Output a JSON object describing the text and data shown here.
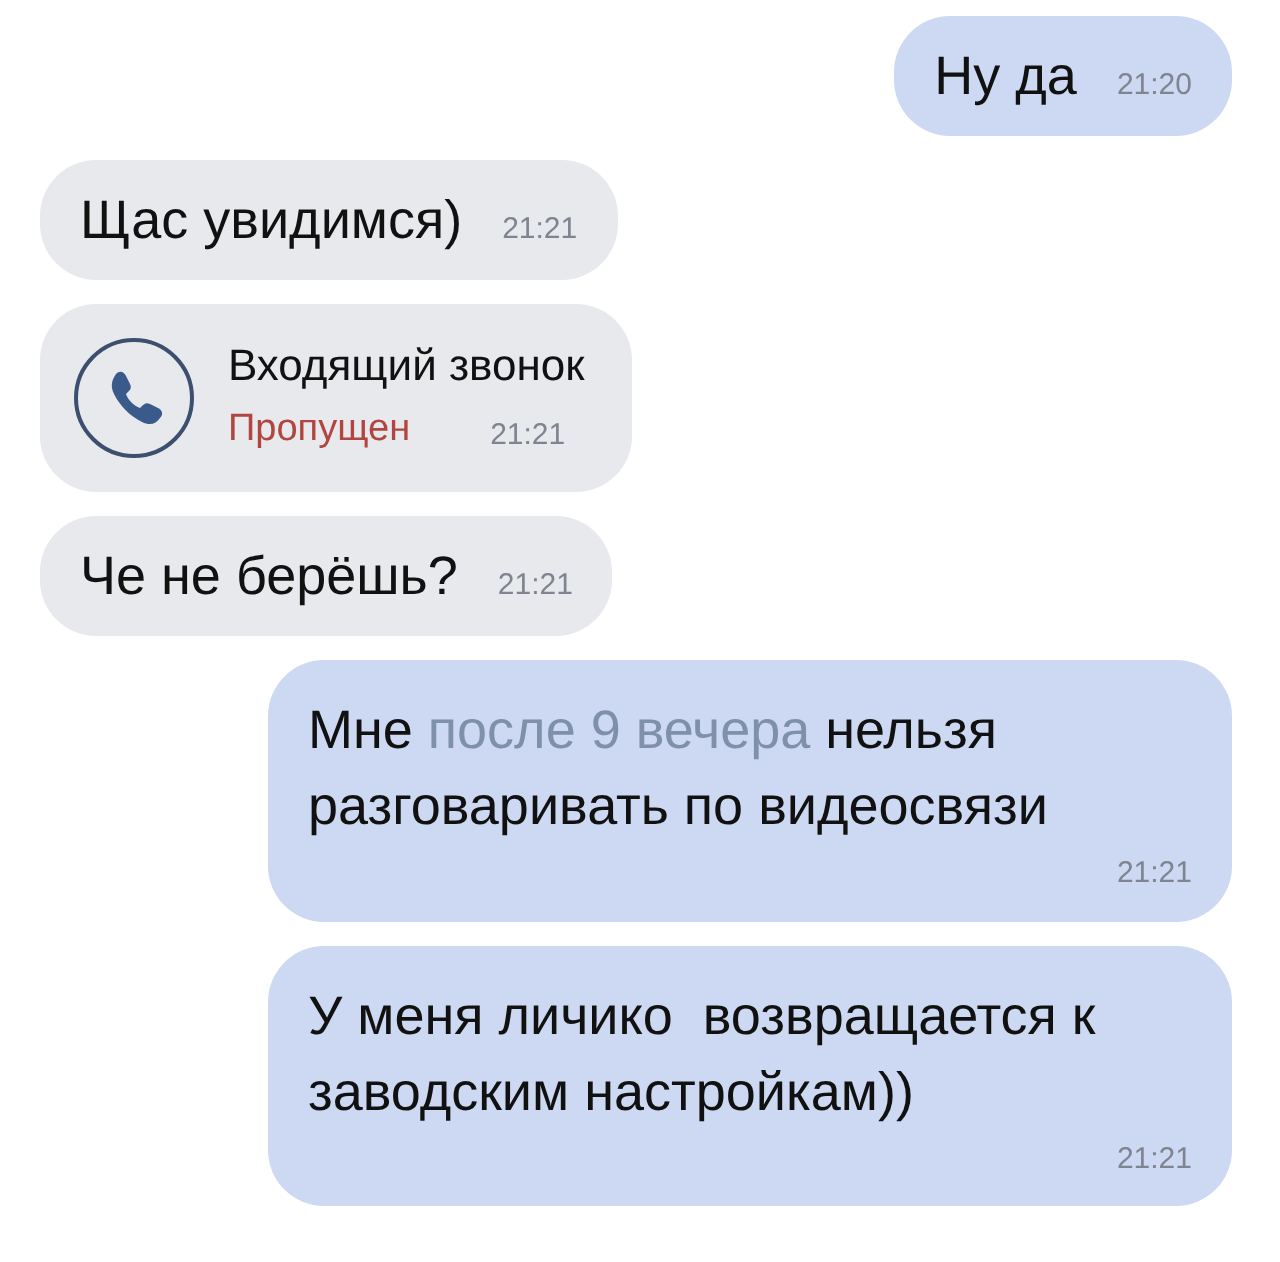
{
  "messages": [
    {
      "outgoing": true,
      "kind": "text",
      "parts": [
        {
          "kind": "plain",
          "text": "Ну да"
        }
      ],
      "time": "21:20"
    },
    {
      "outgoing": false,
      "kind": "text",
      "parts": [
        {
          "kind": "plain",
          "text": "Щас увидимся)"
        }
      ],
      "time": "21:21"
    },
    {
      "outgoing": false,
      "kind": "call",
      "title": "Входящий звонок",
      "status": "Пропущен",
      "missed": true,
      "time": "21:21"
    },
    {
      "outgoing": false,
      "kind": "text",
      "parts": [
        {
          "kind": "plain",
          "text": "Че не берёшь?"
        }
      ],
      "time": "21:21"
    },
    {
      "outgoing": true,
      "kind": "paragraph",
      "parts": [
        {
          "kind": "plain",
          "text": "Мне "
        },
        {
          "kind": "link",
          "text": "после 9 вечера"
        },
        {
          "kind": "plain",
          "text": " нельзя разговаривать по видеосвязи"
        }
      ],
      "time": "21:21"
    },
    {
      "outgoing": true,
      "kind": "paragraph",
      "parts": [
        {
          "kind": "plain",
          "text": "У меня личико  возвращается к заводским настройкам))"
        }
      ],
      "time": "21:21"
    }
  ]
}
